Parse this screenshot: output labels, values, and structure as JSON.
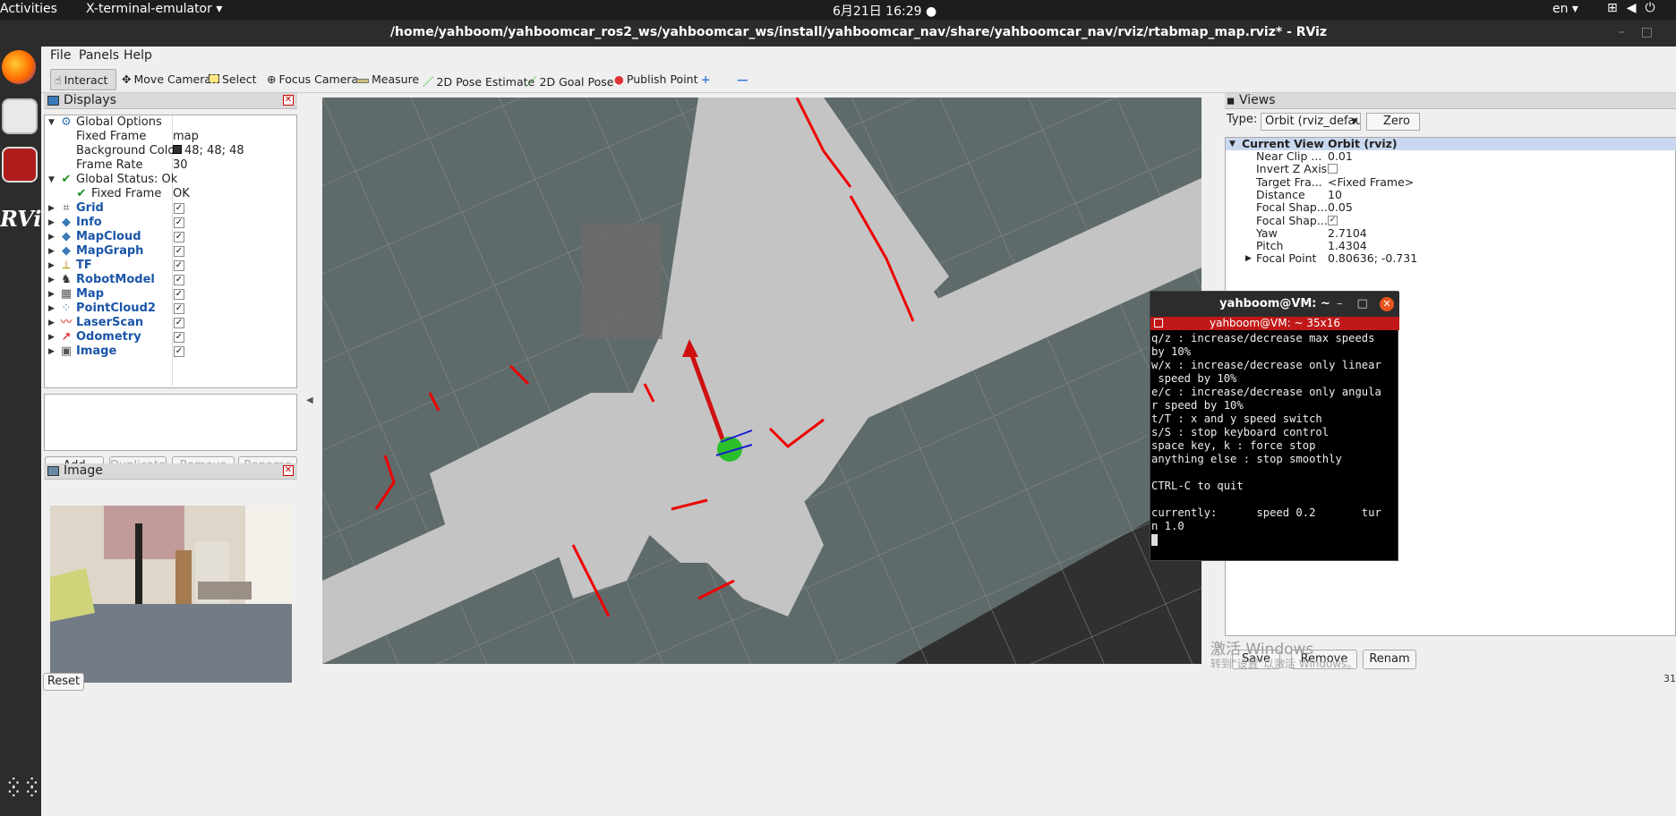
{
  "topbar": {
    "activities": "Activities",
    "app_menu": "X-terminal-emulator ▾",
    "clock": "6月21日  16:29  ●",
    "lang": "en ▾",
    "tray_icons": [
      "network-icon",
      "volume-icon",
      "power-icon"
    ]
  },
  "window": {
    "title": "/home/yahboom/yahboomcar_ros2_ws/yahboomcar_ws/install/yahboomcar_nav/share/yahboomcar_nav/rviz/rtabmap_map.rviz* - RViz"
  },
  "menu": {
    "file": "File",
    "panels": "Panels",
    "help": "Help"
  },
  "toolbar": {
    "interact": "Interact",
    "move_camera": "Move Camera",
    "select": "Select",
    "focus_camera": "Focus Camera",
    "measure": "Measure",
    "pose_estimate": "2D Pose Estimate",
    "goal_pose": "2D Goal Pose",
    "publish_point": "Publish Point",
    "plus": "+",
    "minus": "—"
  },
  "displays": {
    "title": "Displays",
    "global_options": "Global Options",
    "fixed_frame_label": "Fixed Frame",
    "fixed_frame_value": "map",
    "bg_color_label": "Background Color",
    "bg_color_value": "48; 48; 48",
    "frame_rate_label": "Frame Rate",
    "frame_rate_value": "30",
    "global_status": "Global Status: Ok",
    "status_fixed_frame": "Fixed Frame",
    "status_fixed_frame_value": "OK",
    "items": [
      {
        "label": "Grid"
      },
      {
        "label": "Info"
      },
      {
        "label": "MapCloud"
      },
      {
        "label": "MapGraph"
      },
      {
        "label": "TF"
      },
      {
        "label": "RobotModel"
      },
      {
        "label": "Map"
      },
      {
        "label": "PointCloud2"
      },
      {
        "label": "LaserScan"
      },
      {
        "label": "Odometry"
      },
      {
        "label": "Image"
      }
    ],
    "buttons": {
      "add": "Add",
      "duplicate": "Duplicate",
      "remove": "Remove",
      "rename": "Rename"
    }
  },
  "image_panel": {
    "title": "Image"
  },
  "reset_button": "Reset",
  "views": {
    "title": "Views",
    "type_label": "Type:",
    "type_value": "Orbit (rviz_defau",
    "zero_button": "Zero",
    "current_view": "Current View",
    "current_view_value": "Orbit (rviz)",
    "props": [
      {
        "k": "Near Clip ...",
        "v": "0.01"
      },
      {
        "k": "Invert Z Axis",
        "v": ""
      },
      {
        "k": "Target Fra...",
        "v": "<Fixed Frame>"
      },
      {
        "k": "Distance",
        "v": "10"
      },
      {
        "k": "Focal Shap...",
        "v": "0.05"
      },
      {
        "k": "Focal Shap...",
        "v": ""
      },
      {
        "k": "Yaw",
        "v": "2.7104"
      },
      {
        "k": "Pitch",
        "v": "1.4304"
      },
      {
        "k": "Focal Point",
        "v": "0.80636; -0.731"
      }
    ],
    "buttons": {
      "save": "Save",
      "remove": "Remove",
      "rename": "Renam"
    }
  },
  "terminal": {
    "title": "yahboom@VM: ~",
    "tab": "yahboom@VM: ~ 35x16",
    "lines": [
      "q/z : increase/decrease max speeds",
      "by 10%",
      "w/x : increase/decrease only linear",
      " speed by 10%",
      "e/c : increase/decrease only angula",
      "r speed by 10%",
      "t/T : x and y speed switch",
      "s/S : stop keyboard control",
      "space key, k : force stop",
      "anything else : stop smoothly",
      "",
      "CTRL-C to quit",
      "",
      "currently:      speed 0.2       tur",
      "n 1.0"
    ]
  },
  "watermark": {
    "line1": "激活 Windows",
    "line2": "转到\"设置\"以激活 Windows。"
  },
  "corner_fragment": "31",
  "colors": {
    "laser": "#ff0000",
    "map_free": "#c4c4c4",
    "map_unknown": "#5e6b6b",
    "bg": "#303030"
  }
}
